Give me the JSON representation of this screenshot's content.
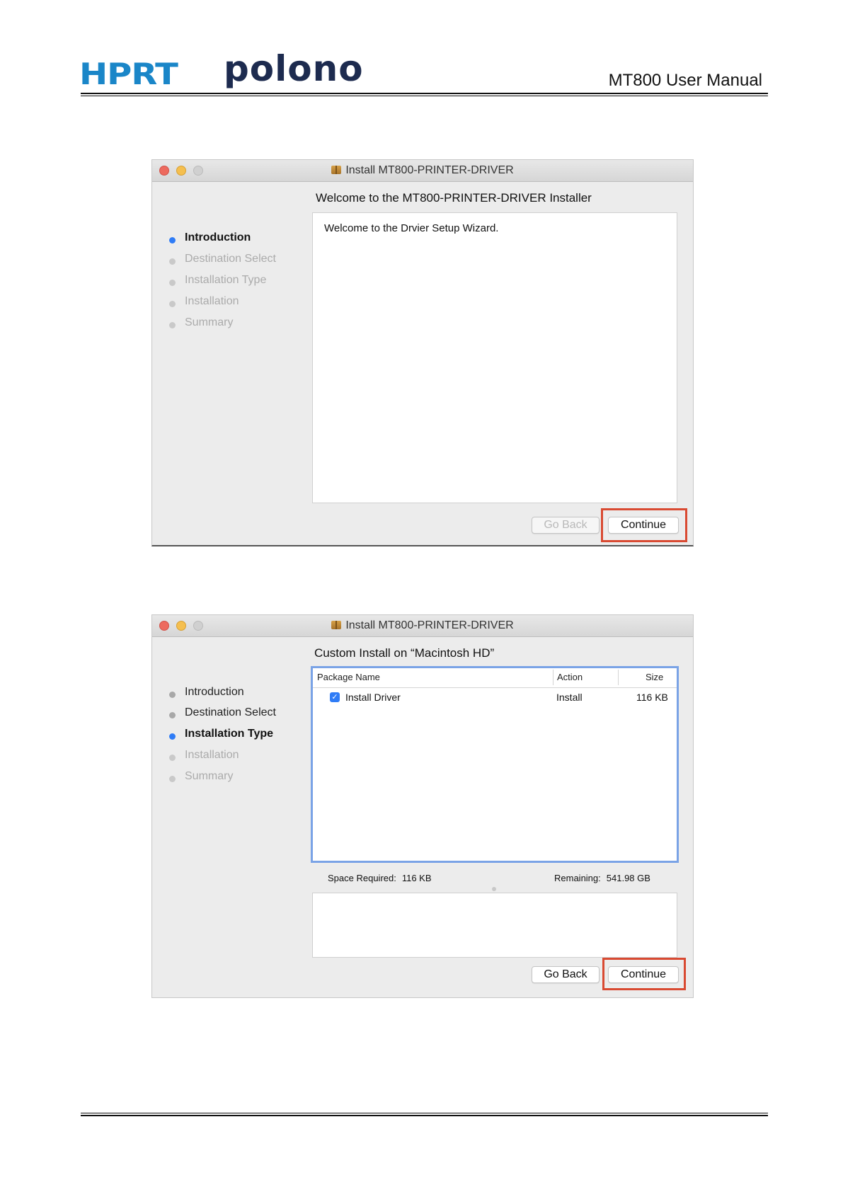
{
  "header": {
    "logo_hprt": "HPRT",
    "logo_polono": "polono",
    "doc_title": "MT800 User Manual"
  },
  "window1": {
    "title": "Install MT800-PRINTER-DRIVER",
    "heading": "Welcome to the MT800-PRINTER-DRIVER Installer",
    "steps": [
      {
        "label": "Introduction",
        "state": "active"
      },
      {
        "label": "Destination Select",
        "state": "future"
      },
      {
        "label": "Installation Type",
        "state": "future"
      },
      {
        "label": "Installation",
        "state": "future"
      },
      {
        "label": "Summary",
        "state": "future"
      }
    ],
    "body_text": "Welcome to the Drvier Setup Wizard.",
    "go_back_label": "Go Back",
    "continue_label": "Continue"
  },
  "window2": {
    "title": "Install MT800-PRINTER-DRIVER",
    "heading": "Custom Install on “Macintosh HD”",
    "steps": [
      {
        "label": "Introduction",
        "state": "done"
      },
      {
        "label": "Destination Select",
        "state": "done"
      },
      {
        "label": "Installation Type",
        "state": "active"
      },
      {
        "label": "Installation",
        "state": "future"
      },
      {
        "label": "Summary",
        "state": "future"
      }
    ],
    "table": {
      "headers": [
        "Package Name",
        "Action",
        "Size"
      ],
      "rows": [
        {
          "package": "Install Driver",
          "action": "Install",
          "size": "116 KB",
          "checked": true
        }
      ]
    },
    "space_required_label": "Space Required:",
    "space_required_value": "116 KB",
    "remaining_label": "Remaining:",
    "remaining_value": "541.98 GB",
    "go_back_label": "Go Back",
    "continue_label": "Continue"
  },
  "colors": {
    "highlight": "#d94a32",
    "active_step": "#2f7cf6",
    "hprt_blue": "#1a86c8",
    "polono_navy": "#1d2b4f"
  }
}
